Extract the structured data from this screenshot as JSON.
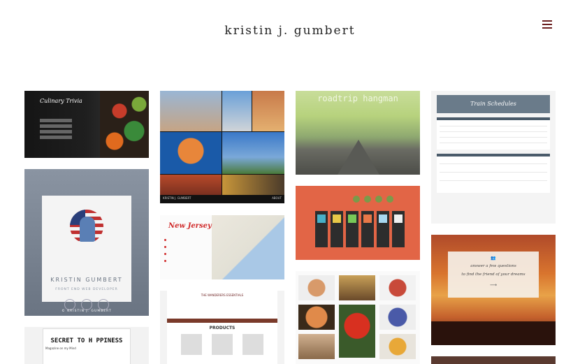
{
  "header": {
    "title": "kristin j. gumbert"
  },
  "tiles": {
    "culinary": {
      "title": "Culinary Trivia"
    },
    "portfolio": {
      "name": "KRISTIN GUMBERT",
      "role": "FRONT END WEB DEVELOPER",
      "footer": "© KRISTIN J. GUMBERT"
    },
    "secret": {
      "title": "SECRET TO H PPINESS",
      "subtitle": "Magazine on my Mind"
    },
    "sf": {
      "footer_left": "KRISTIN J. GUMBERT",
      "footer_right": "ABOUT"
    },
    "nj": {
      "title": "New Jersey"
    },
    "wanderers": {
      "logo": "THE WANDERERS ESSENTIALS",
      "products": "PRODUCTS"
    },
    "roadtrip": {
      "title": "roadtrip hangman"
    },
    "train": {
      "title": "Train Schedules"
    },
    "sunset": {
      "line1": "answer a few questions",
      "line2": "to find the friend of your dreams"
    }
  },
  "colors": {
    "accent": "#6b1f1f",
    "background": "#ffffff"
  },
  "icons": {
    "menu": "hamburger-menu-icon"
  }
}
